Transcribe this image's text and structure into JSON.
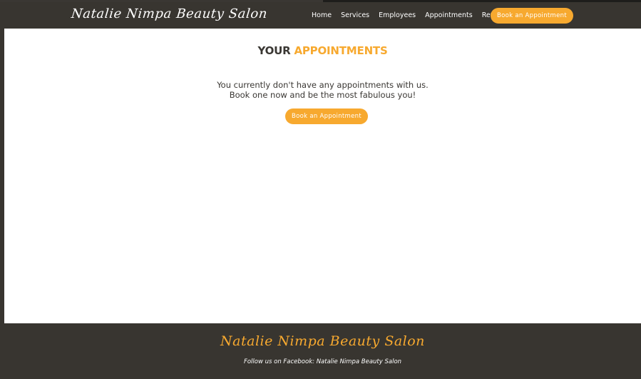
{
  "header": {
    "brand": "Natalie Nimpa Beauty Salon",
    "nav": [
      "Home",
      "Services",
      "Employees",
      "Appointments",
      "Reviews"
    ],
    "cta_label": "Book an Appointment"
  },
  "main": {
    "title_prefix": "YOUR",
    "title_accent": "APPOINTMENTS",
    "message_line1": "You currently don't have any appointments with us.",
    "message_line2": "Book one now and be the most fabulous you!",
    "cta_label": "Book an Appointment"
  },
  "footer": {
    "brand": "Natalie Nimpa Beauty Salon",
    "follow_text": "Follow us on Facebook: Natalie Nimpa Beauty Salon"
  },
  "colors": {
    "accent": "#f7a92f",
    "dark": "#383530",
    "background": "#ffffff"
  }
}
